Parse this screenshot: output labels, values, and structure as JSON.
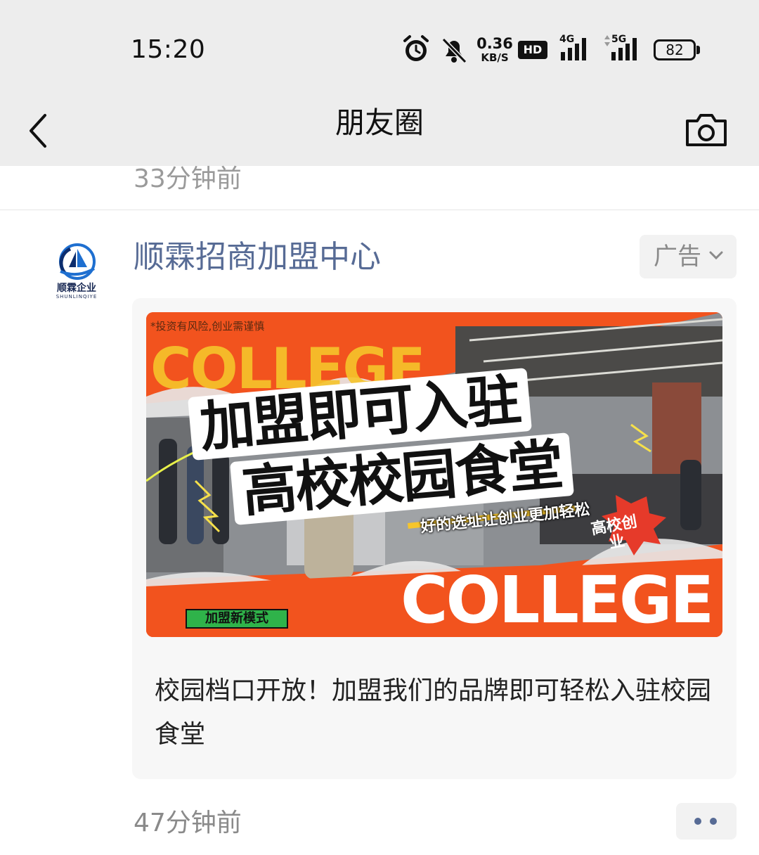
{
  "status_bar": {
    "time": "15:20",
    "net_speed_value": "0.36",
    "net_speed_unit": "KB/S",
    "hd_label": "HD",
    "signal1_label": "4G",
    "signal2_label": "5G",
    "battery": "82",
    "icons": [
      "alarm-icon",
      "mute-icon",
      "signal-4g-icon",
      "signal-5g-icon",
      "battery-icon"
    ]
  },
  "nav": {
    "title": "朋友圈",
    "back_icon": "chevron-left-icon",
    "camera_icon": "camera-icon"
  },
  "feed": {
    "previous_post_time": "33分钟前",
    "post": {
      "avatar_text": "顺霖企业",
      "avatar_subtext": "SHUNLINQIYE",
      "name": "顺霖招商加盟中心",
      "ad_label": "广告",
      "image": {
        "disclaimer": "*投资有风险,创业需谨慎",
        "college_top": "COLLEGE",
        "headline_line1": "加盟即可入驻",
        "headline_line2": "高校校园食堂",
        "slogan": "好的选址让创业更加轻松",
        "burst_text": "高校创业",
        "college_bottom": "COLLEGE",
        "new_mode_tag": "加盟新模式"
      },
      "text": "校园档口开放！加盟我们的品牌即可轻松入驻校园食堂"
    },
    "next_post_time": "47分钟前"
  },
  "colors": {
    "nav_bg": "#ededed",
    "name_link": "#576b95",
    "ad_orange": "#f2531e",
    "accent_yellow": "#f6c52b",
    "tag_green": "#2fb34a"
  }
}
